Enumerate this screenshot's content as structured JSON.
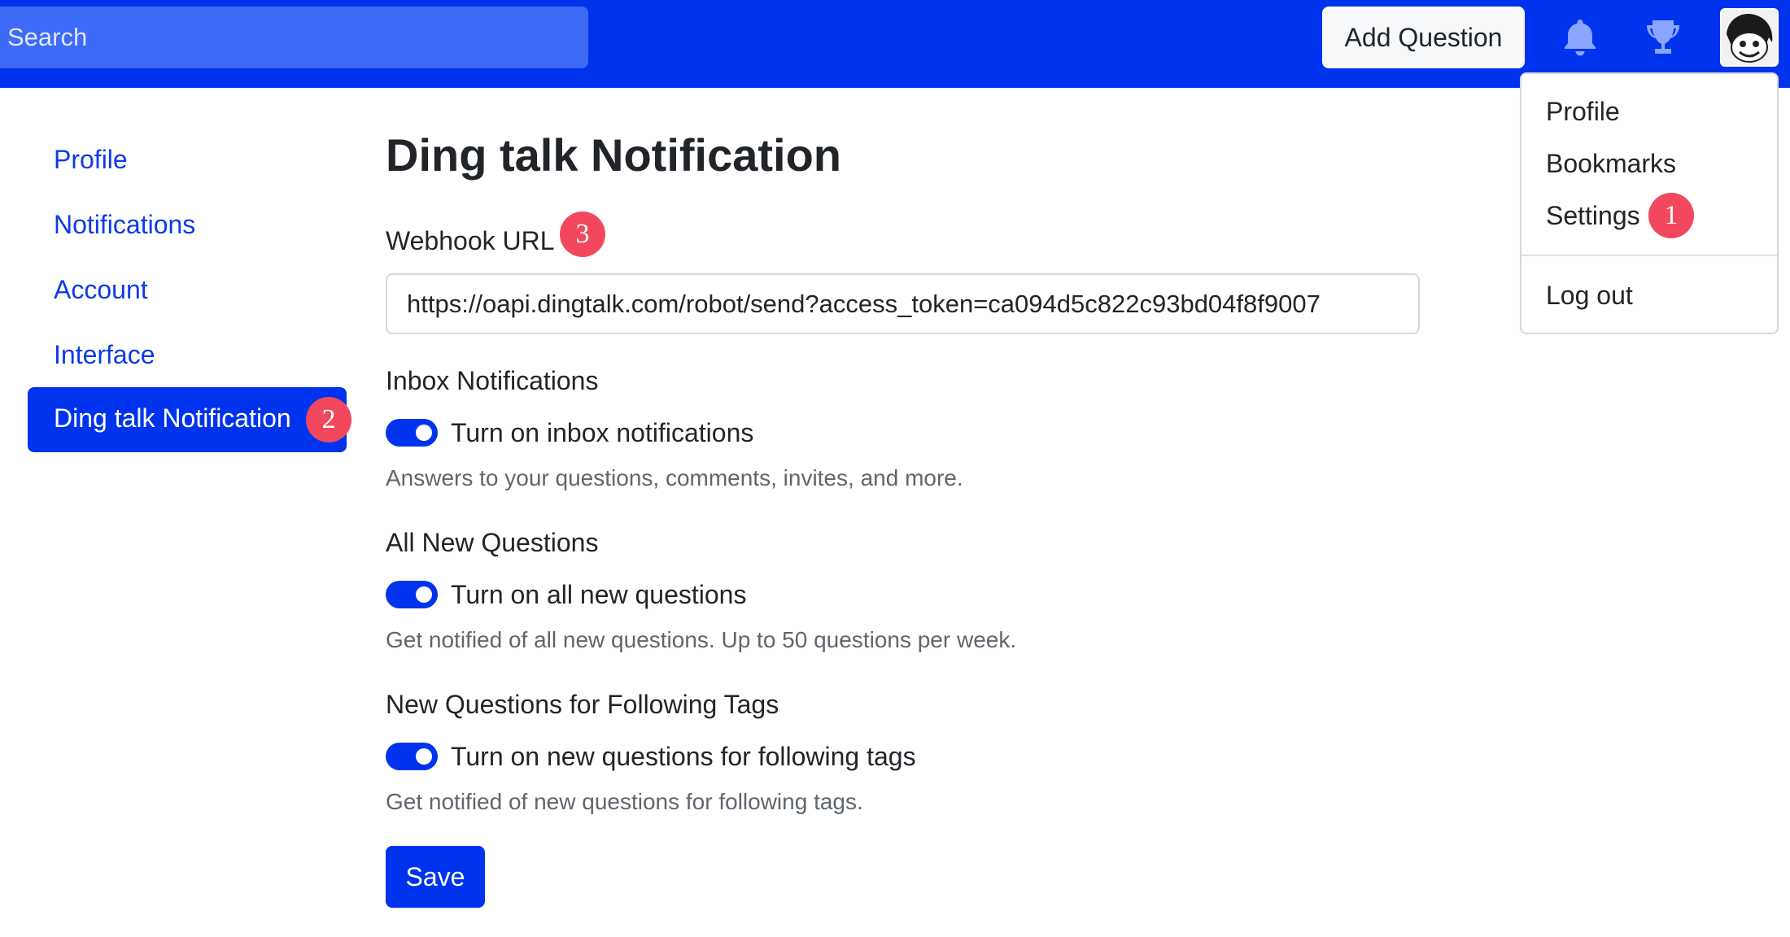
{
  "header": {
    "search_placeholder": "Search",
    "add_question_label": "Add Question",
    "icons": [
      "bell-icon",
      "trophy-icon",
      "avatar"
    ]
  },
  "user_menu": {
    "items": [
      {
        "label": "Profile"
      },
      {
        "label": "Bookmarks"
      },
      {
        "label": "Settings"
      },
      {
        "label": "Log out"
      }
    ]
  },
  "annotations": {
    "badge1": "1",
    "badge2": "2",
    "badge3": "3"
  },
  "sidebar": {
    "items": [
      {
        "label": "Profile"
      },
      {
        "label": "Notifications"
      },
      {
        "label": "Account"
      },
      {
        "label": "Interface"
      },
      {
        "label": "Ding talk Notification",
        "active": true
      }
    ]
  },
  "main": {
    "title": "Ding talk Notification",
    "webhook": {
      "label": "Webhook URL",
      "value": "https://oapi.dingtalk.com/robot/send?access_token=ca094d5c822c93bd04f8f9007"
    },
    "sections": [
      {
        "heading": "Inbox Notifications",
        "toggle_label": "Turn on inbox notifications",
        "enabled": true,
        "help": "Answers to your questions, comments, invites, and more."
      },
      {
        "heading": "All New Questions",
        "toggle_label": "Turn on all new questions",
        "enabled": true,
        "help": "Get notified of all new questions. Up to 50 questions per week."
      },
      {
        "heading": "New Questions for Following Tags",
        "toggle_label": "Turn on new questions for following tags",
        "enabled": true,
        "help": "Get notified of new questions for following tags."
      }
    ],
    "save_label": "Save"
  },
  "colors": {
    "brand": "#0033ee",
    "badge": "#f2485e",
    "link": "#0b3be8"
  }
}
